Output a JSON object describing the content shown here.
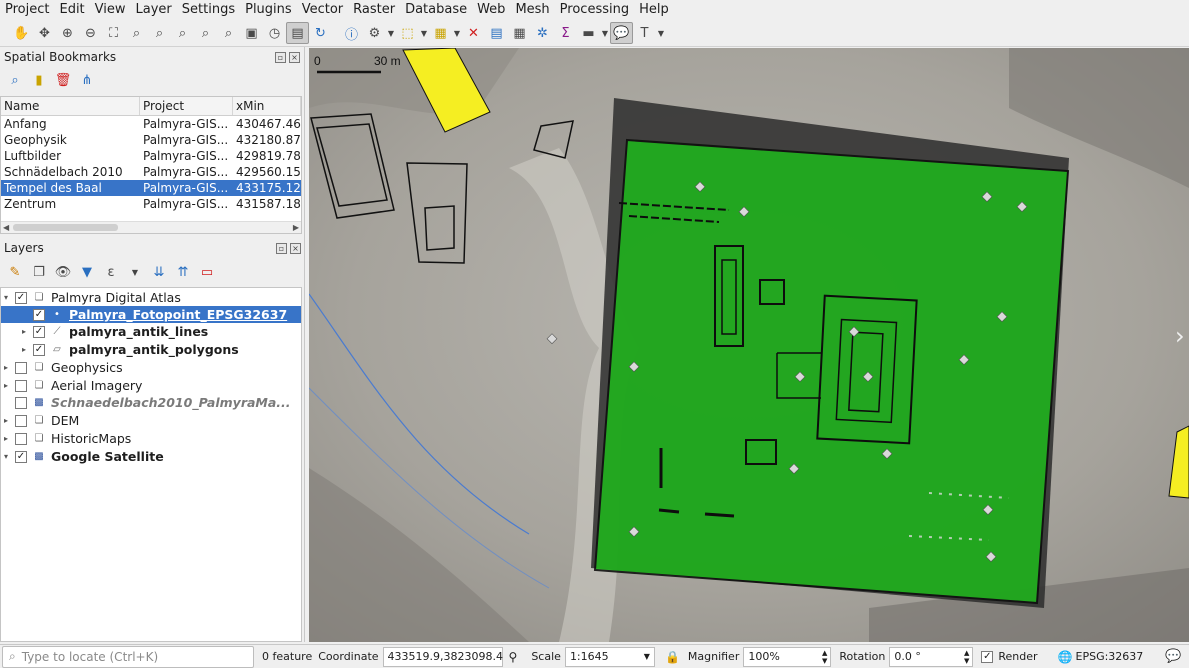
{
  "menu": [
    "Project",
    "Edit",
    "View",
    "Layer",
    "Settings",
    "Plugins",
    "Vector",
    "Raster",
    "Database",
    "Web",
    "Mesh",
    "Processing",
    "Help"
  ],
  "bookmarks": {
    "title": "Spatial Bookmarks",
    "columns": [
      "Name",
      "Project",
      "xMin"
    ],
    "rows": [
      {
        "name": "Anfang",
        "project": "Palmyra-GIS...",
        "xmin": "430467.46"
      },
      {
        "name": "Geophysik",
        "project": "Palmyra-GIS...",
        "xmin": "432180.87"
      },
      {
        "name": "Luftbilder",
        "project": "Palmyra-GIS...",
        "xmin": "429819.78"
      },
      {
        "name": "Schnädelbach 2010",
        "project": "Palmyra-GIS...",
        "xmin": "429560.15"
      },
      {
        "name": "Tempel des Baal",
        "project": "Palmyra-GIS...",
        "xmin": "433175.12"
      },
      {
        "name": "Zentrum",
        "project": "Palmyra-GIS...",
        "xmin": "431587.18"
      }
    ]
  },
  "layers": {
    "title": "Layers",
    "items": [
      {
        "label": "Palmyra Digital Atlas",
        "checked": true,
        "expanded": true,
        "icon": "group-icon"
      },
      {
        "label": "Palmyra_Fotopoint_EPSG32637",
        "checked": true,
        "icon": "point-layer-icon",
        "selected": true
      },
      {
        "label": "palmyra_antik_lines",
        "checked": true,
        "icon": "line-layer-icon"
      },
      {
        "label": "palmyra_antik_polygons",
        "checked": true,
        "icon": "polygon-layer-icon"
      },
      {
        "label": "Geophysics",
        "checked": false,
        "icon": "group-icon"
      },
      {
        "label": "Aerial Imagery",
        "checked": false,
        "icon": "group-icon"
      },
      {
        "label": "Schnaedelbach2010_PalmyraMa...",
        "checked": false,
        "icon": "raster-layer-icon"
      },
      {
        "label": "DEM",
        "checked": false,
        "icon": "group-icon"
      },
      {
        "label": "HistoricMaps",
        "checked": false,
        "icon": "group-icon"
      },
      {
        "label": "Google Satellite",
        "checked": true,
        "icon": "raster-layer-icon"
      }
    ]
  },
  "map": {
    "scalebar_start": "0",
    "scalebar_end": "30 m",
    "colors": {
      "polygon_fill": "#1fb51c",
      "highlight": "#f5ee22",
      "lines": "#111111"
    }
  },
  "status": {
    "locate_placeholder": "Type to locate (Ctrl+K)",
    "feature_count": "0 feature",
    "coordinate_label": "Coordinate",
    "coordinate_value": "433519.9,3823098.4",
    "scale_label": "Scale",
    "scale_value": "1:1645",
    "magnifier_label": "Magnifier",
    "magnifier_value": "100%",
    "rotation_label": "Rotation",
    "rotation_value": "0.0 °",
    "render_label": "Render",
    "crs": "EPSG:32637"
  }
}
